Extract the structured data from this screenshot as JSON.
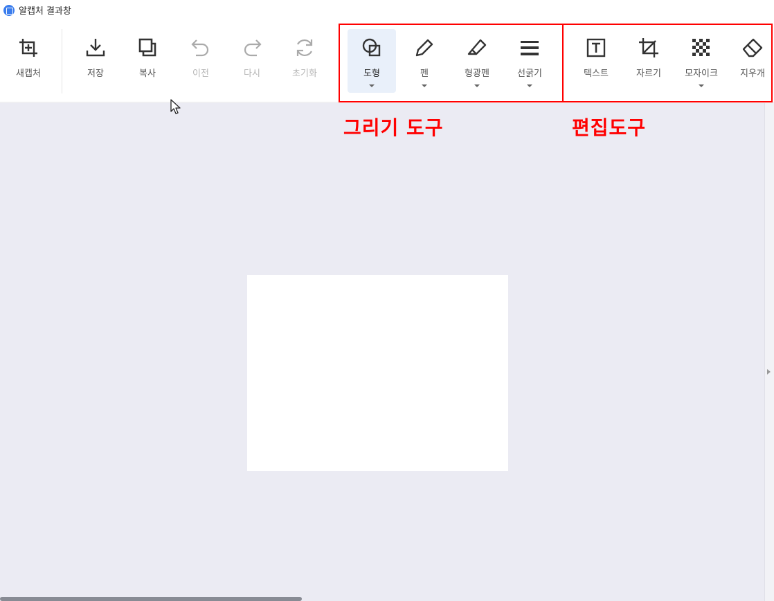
{
  "window": {
    "title": "알캡처 결과창"
  },
  "toolbar": {
    "tools": [
      {
        "id": "new-capture",
        "label": "새캡처"
      },
      {
        "id": "save",
        "label": "저장"
      },
      {
        "id": "copy",
        "label": "복사"
      },
      {
        "id": "undo",
        "label": "이전"
      },
      {
        "id": "redo",
        "label": "다시"
      },
      {
        "id": "reset",
        "label": "초기화"
      },
      {
        "id": "shape",
        "label": "도형"
      },
      {
        "id": "pen",
        "label": "펜"
      },
      {
        "id": "highlighter",
        "label": "형광펜"
      },
      {
        "id": "line-thickness",
        "label": "선굵기"
      },
      {
        "id": "text",
        "label": "텍스트"
      },
      {
        "id": "crop",
        "label": "자르기"
      },
      {
        "id": "mosaic",
        "label": "모자이크"
      },
      {
        "id": "eraser",
        "label": "지우개"
      }
    ]
  },
  "annotations": {
    "drawing_tools": "그리기 도구",
    "edit_tools": "편집도구"
  },
  "colors": {
    "highlight": "#ff0000",
    "canvas_bg": "#ebebf3",
    "active_tool_bg": "#e9f0fa",
    "app_icon": "#3b7ded"
  }
}
